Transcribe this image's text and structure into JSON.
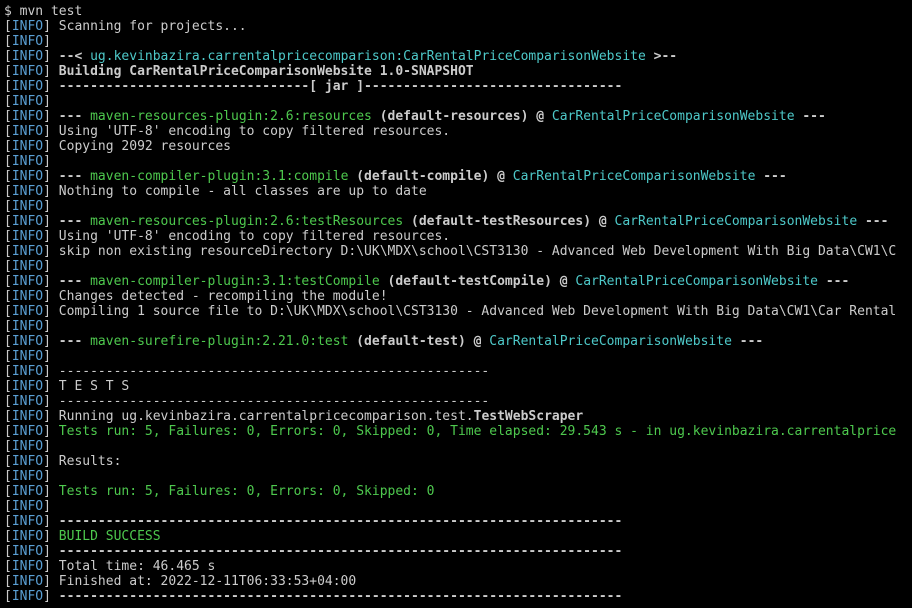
{
  "prompt": "$ mvn test",
  "infoLabel": "INFO",
  "lines": {
    "scanning": "Scanning for projects...",
    "projectHeader": {
      "pre": "--< ",
      "project": "ug.kevinbazira.carrentalpricecomparison:CarRentalPriceComparisonWebsite",
      "post": " >--"
    },
    "building": "Building CarRentalPriceComparisonWebsite 1.0-SNAPSHOT",
    "jarLine": "--------------------------------[ jar ]---------------------------------",
    "resources": {
      "dash": "--- ",
      "plugin": "maven-resources-plugin:2.6:resources",
      "goal": " (default-resources) @ ",
      "artifact": "CarRentalPriceComparisonWebsite",
      "end": " ---"
    },
    "utf8": "Using 'UTF-8' encoding to copy filtered resources.",
    "copying": "Copying 2092 resources",
    "compile": {
      "dash": "--- ",
      "plugin": "maven-compiler-plugin:3.1:compile",
      "goal": " (default-compile) @ ",
      "artifact": "CarRentalPriceComparisonWebsite",
      "end": " ---"
    },
    "nothingCompile": "Nothing to compile - all classes are up to date",
    "testResources": {
      "dash": "--- ",
      "plugin": "maven-resources-plugin:2.6:testResources",
      "goal": " (default-testResources) @ ",
      "artifact": "CarRentalPriceComparisonWebsite",
      "end": " ---"
    },
    "skipDir": "skip non existing resourceDirectory D:\\UK\\MDX\\school\\CST3130 - Advanced Web Development With Big Data\\CW1\\C",
    "testCompile": {
      "dash": "--- ",
      "plugin": "maven-compiler-plugin:3.1:testCompile",
      "goal": " (default-testCompile) @ ",
      "artifact": "CarRentalPriceComparisonWebsite",
      "end": " ---"
    },
    "changes": "Changes detected - recompiling the module!",
    "compiling": "Compiling 1 source file to D:\\UK\\MDX\\school\\CST3130 - Advanced Web Development With Big Data\\CW1\\Car Rental",
    "surefire": {
      "dash": "--- ",
      "plugin": "maven-surefire-plugin:2.21.0:test",
      "goal": " (default-test) @ ",
      "artifact": "CarRentalPriceComparisonWebsite",
      "end": " ---"
    },
    "sep": "-------------------------------------------------------",
    "tests": " T E S T S",
    "running": {
      "pre": "Running ug.kevinbazira.carrentalpricecomparison.test.",
      "cls": "TestWebScraper"
    },
    "testsRun": "Tests run: 5, Failures: 0, Errors: 0, Skipped: 0, Time elapsed: 29.543 s - in ug.kevinbazira.carrentalprice",
    "results": "Results:",
    "summary": "Tests run: 5, Failures: 0, Errors: 0, Skipped: 0",
    "longSep": "------------------------------------------------------------------------",
    "buildSuccess": "BUILD SUCCESS",
    "totalTime": "Total time:  46.465 s",
    "finished": "Finished at: 2022-12-11T06:33:53+04:00"
  }
}
